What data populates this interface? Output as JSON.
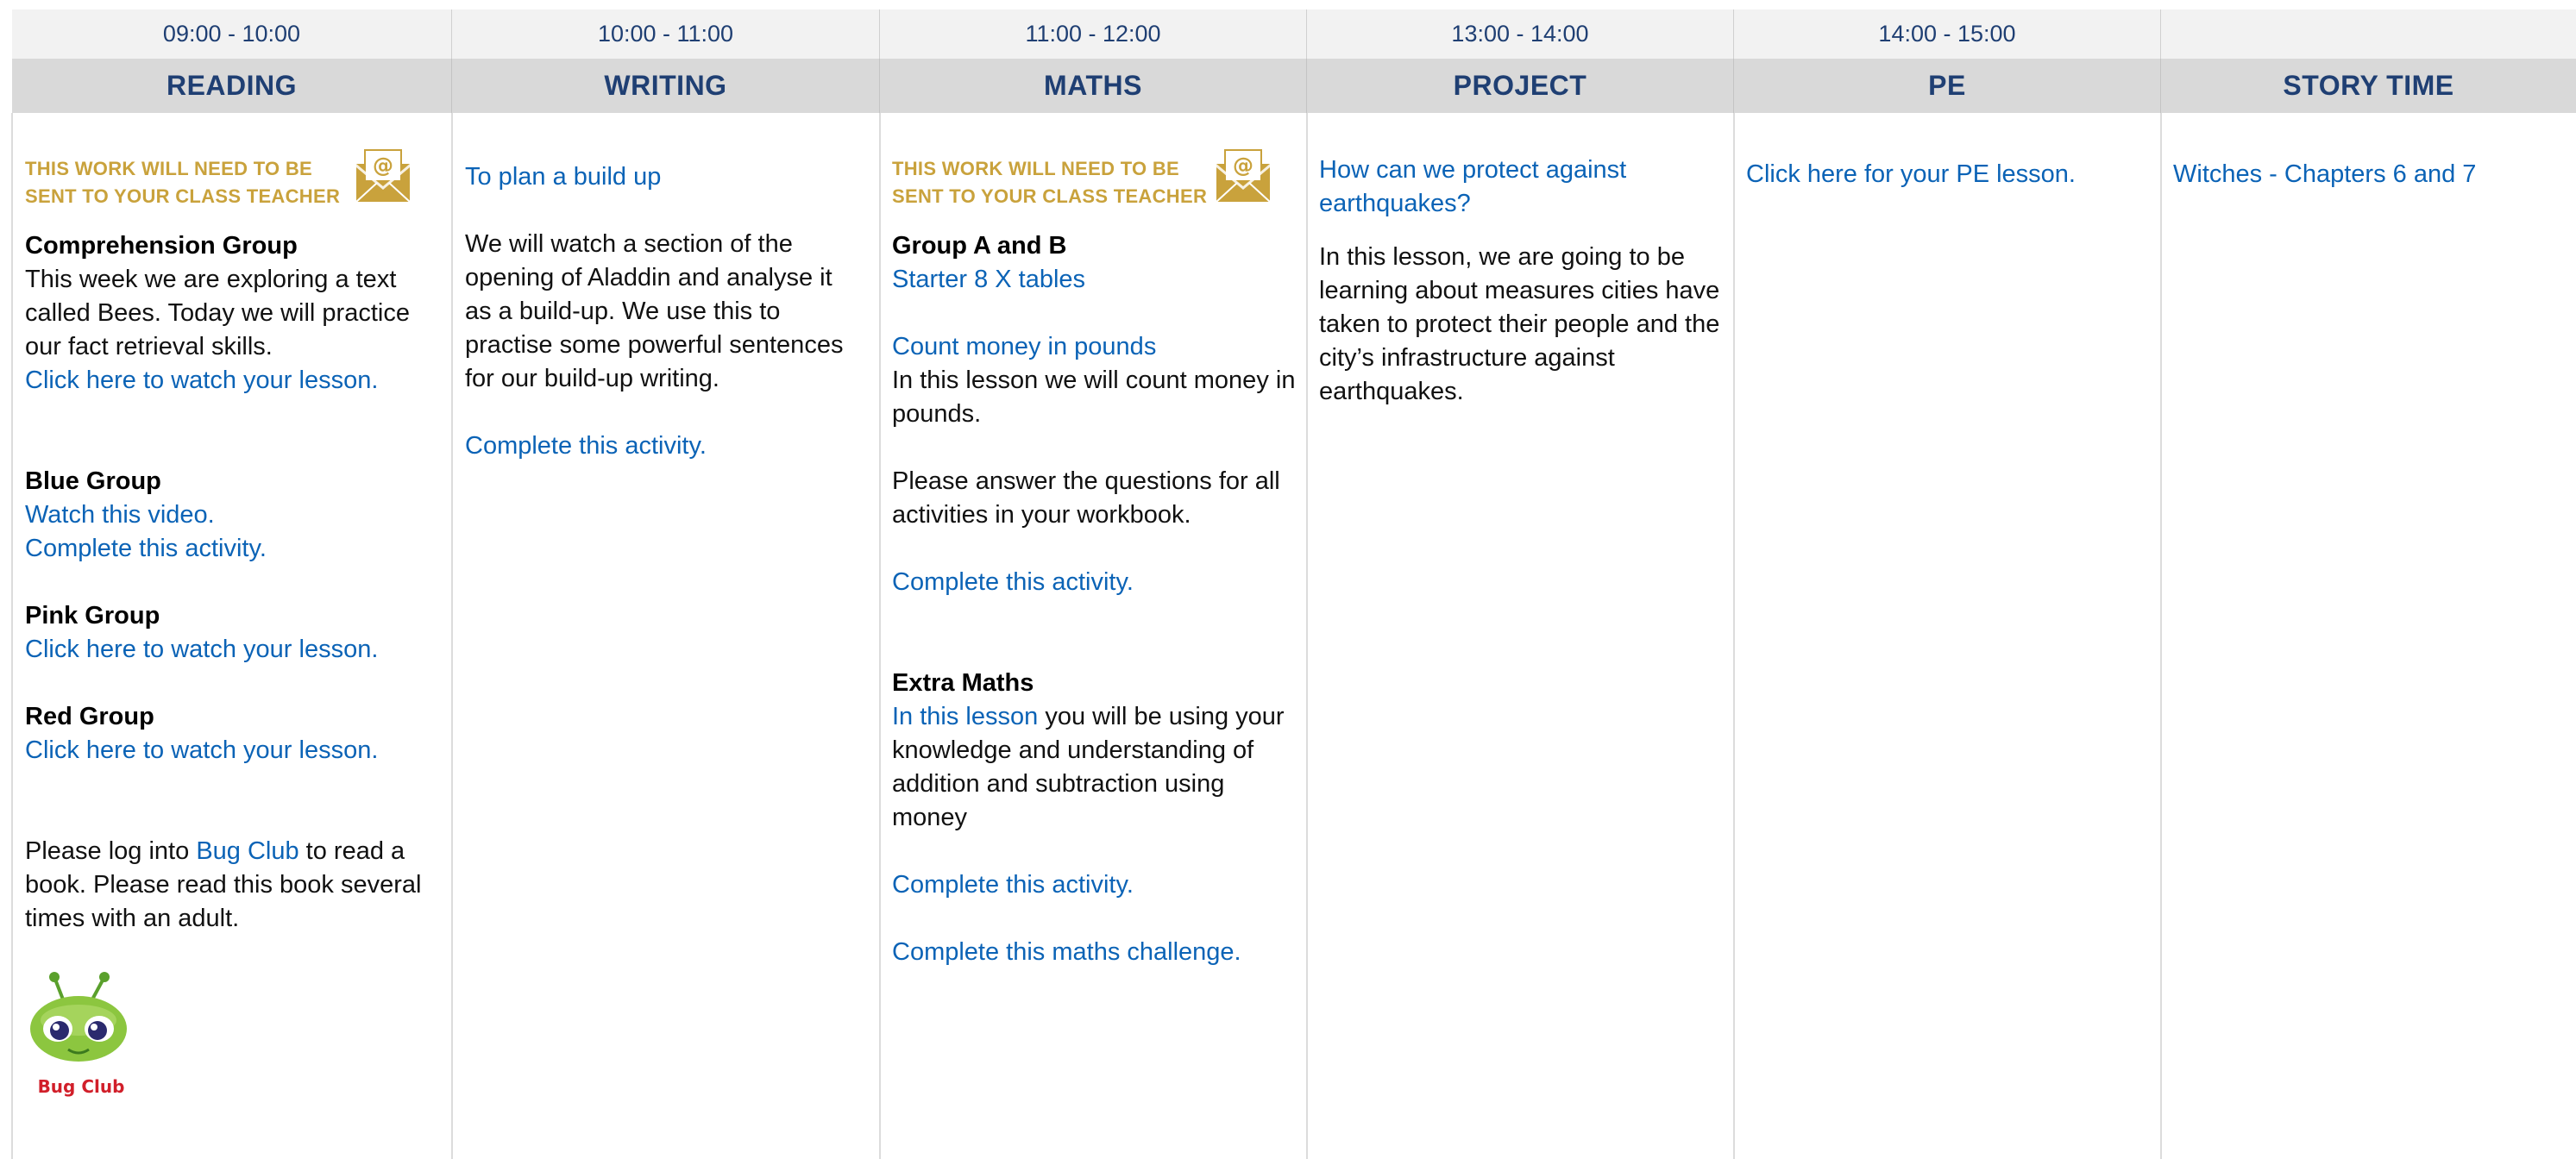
{
  "times": [
    "09:00 - 10:00",
    "10:00 - 11:00",
    "11:00 - 12:00",
    "13:00 - 14:00",
    "14:00 - 15:00",
    ""
  ],
  "subjects": [
    "READING",
    "WRITING",
    "MATHS",
    "PROJECT",
    "PE",
    "STORY TIME"
  ],
  "colors": {
    "header_text": "#1f3f73",
    "link": "#0b63b6",
    "notice": "#c9a23c",
    "time_bg": "#f2f2f2",
    "subject_bg": "#d9d9d9"
  },
  "reading": {
    "notice_line1": "THIS WORK WILL NEED TO BE",
    "notice_line2": "SENT TO YOUR CLASS TEACHER",
    "notice_icon": "email-envelope-icon",
    "comprehension_title": "Comprehension Group",
    "comprehension_text": "This week we are exploring a text called Bees. Today we will practice our fact retrieval skills.",
    "comprehension_link": "Click here to watch your lesson.",
    "blue_title": "Blue Group",
    "blue_link1": "Watch this video.",
    "blue_link2": "Complete this activity.",
    "pink_title": "Pink Group",
    "pink_link": "Click here to watch your lesson.",
    "red_title": "Red Group",
    "red_link": "Click here to watch your lesson.",
    "bugclub_before": "Please log into ",
    "bugclub_link": "Bug Club",
    "bugclub_after": " to read a book. Please read this book several times with an adult.",
    "bugclub_logo_text": "Bug Club"
  },
  "writing": {
    "title_link": "To plan a build up",
    "text": "We will watch a section of the opening of Aladdin and analyse it as a build-up. We use this to practise some powerful sentences for our build-up writing.",
    "activity_link": "Complete this activity."
  },
  "maths": {
    "notice_line1": "THIS WORK WILL NEED TO BE",
    "notice_line2": "SENT TO YOUR CLASS TEACHER",
    "notice_icon": "email-envelope-icon",
    "group_title": "Group A and B",
    "starter_link": "Starter 8 X tables",
    "count_link": "Count money in pounds",
    "count_text": "In this lesson we will count money in pounds.",
    "answer_text": "Please answer the questions for all activities in your workbook.",
    "activity_link": "Complete this activity.",
    "extra_title": "Extra Maths",
    "extra_link": "In this lesson",
    "extra_text": " you will be using your knowledge and understanding of addition and subtraction using money",
    "extra_activity_link": "Complete this activity.",
    "challenge_link": "Complete this maths challenge."
  },
  "project": {
    "title_link": "How can we protect against earthquakes?",
    "text": "In this lesson, we are going to be learning about measures cities have taken to protect their people and the city’s infrastructure against earthquakes."
  },
  "pe": {
    "link": "Click here for your PE lesson."
  },
  "story": {
    "link": "Witches - Chapters 6 and 7"
  }
}
